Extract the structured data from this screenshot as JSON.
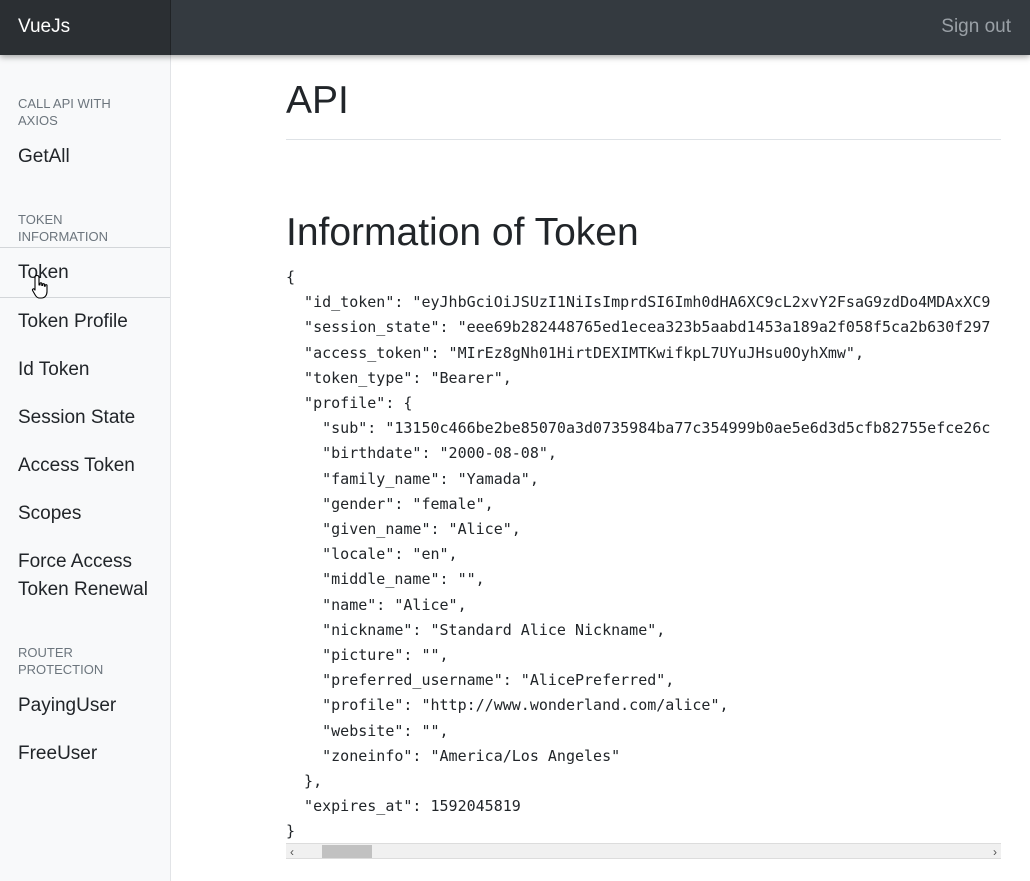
{
  "navbar": {
    "brand": "VueJs",
    "sign_out": "Sign out"
  },
  "sidebar": {
    "sections": [
      {
        "heading": "CALL API WITH AXIOS",
        "items": [
          "GetAll"
        ]
      },
      {
        "heading": "TOKEN INFORMATION",
        "items": [
          "Token",
          "Token Profile",
          "Id Token",
          "Session State",
          "Access Token",
          "Scopes",
          "Force Access Token Renewal"
        ]
      },
      {
        "heading": "ROUTER PROTECTION",
        "items": [
          "PayingUser",
          "FreeUser"
        ]
      }
    ],
    "active_item": "Token"
  },
  "main": {
    "page_title": "API",
    "section_title": "Information of Token",
    "json_lines": [
      "{",
      "  \"id_token\": \"eyJhbGciOiJSUzI1NiIsImprdSI6Imh0dHA6XC9cL2xvY2FsaG9zdDo4MDAxXC9",
      "  \"session_state\": \"eee69b282448765ed1ecea323b5aabd1453a189a2f058f5ca2b630f297",
      "  \"access_token\": \"MIrEz8gNh01HirtDEXIMTKwifkpL7UYuJHsu0OyhXmw\",",
      "  \"token_type\": \"Bearer\",",
      "  \"profile\": {",
      "    \"sub\": \"13150c466be2be85070a3d0735984ba77c354999b0ae5e6d3d5cfb82755efce26c",
      "    \"birthdate\": \"2000-08-08\",",
      "    \"family_name\": \"Yamada\",",
      "    \"gender\": \"female\",",
      "    \"given_name\": \"Alice\",",
      "    \"locale\": \"en\",",
      "    \"middle_name\": \"\",",
      "    \"name\": \"Alice\",",
      "    \"nickname\": \"Standard Alice Nickname\",",
      "    \"picture\": \"\",",
      "    \"preferred_username\": \"AlicePreferred\",",
      "    \"profile\": \"http://www.wonderland.com/alice\",",
      "    \"website\": \"\",",
      "    \"zoneinfo\": \"America/Los Angeles\"",
      "  },",
      "  \"expires_at\": 1592045819",
      "}"
    ]
  },
  "scrollbar": {
    "left_arrow": "‹",
    "right_arrow": "›",
    "position": 0.03
  },
  "icons": {
    "cursor": "hand-pointer-icon"
  }
}
